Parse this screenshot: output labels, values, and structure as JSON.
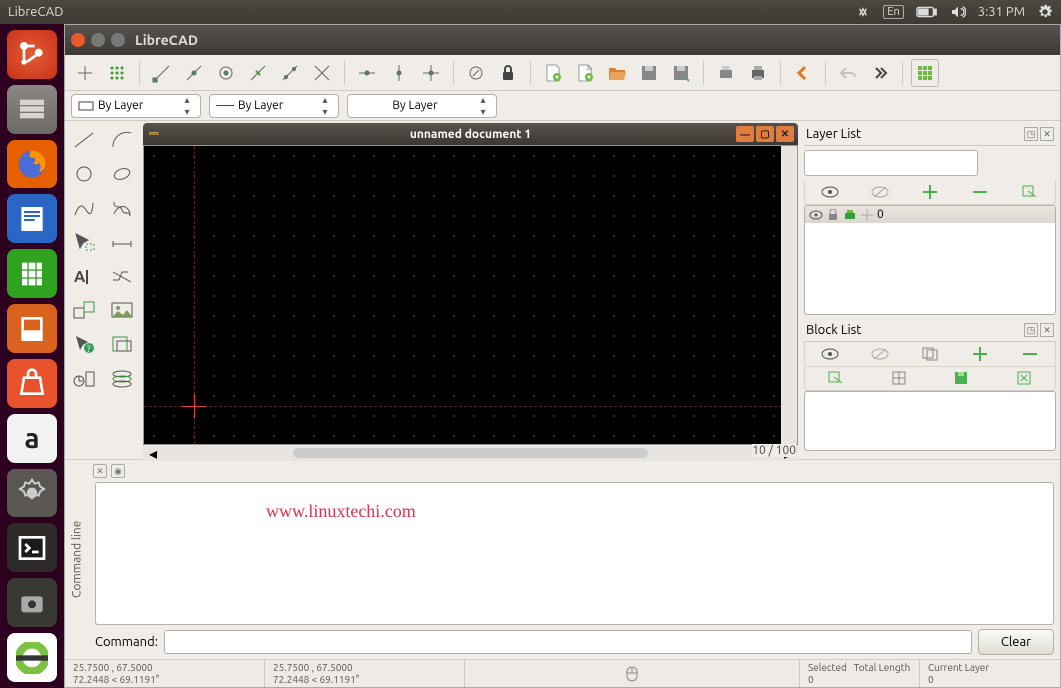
{
  "menubar": {
    "app": "LibreCAD",
    "time": "3:31 PM",
    "lang": "En"
  },
  "window": {
    "title": "LibreCAD"
  },
  "combos": {
    "a": "By Layer",
    "b": "By Layer",
    "c": "By Layer"
  },
  "doc": {
    "title": "unnamed document 1",
    "zoom": "10 / 100"
  },
  "layers": {
    "title": "Layer List",
    "row0": "0"
  },
  "blocks": {
    "title": "Block List"
  },
  "cmd": {
    "label": "Command line",
    "prompt": "Command:",
    "clear": "Clear"
  },
  "wm": "www.linuxtechi.com",
  "status": {
    "c1a": "25.7500 , 67.5000",
    "c1b": "72.2448 < 69.1191°",
    "c2a": "25.7500 , 67.5000",
    "c2b": "72.2448 < 69.1191°",
    "sel": "Selected",
    "tl": "Total Length",
    "tlv": "0",
    "cl": "Current Layer",
    "clv": "0"
  }
}
